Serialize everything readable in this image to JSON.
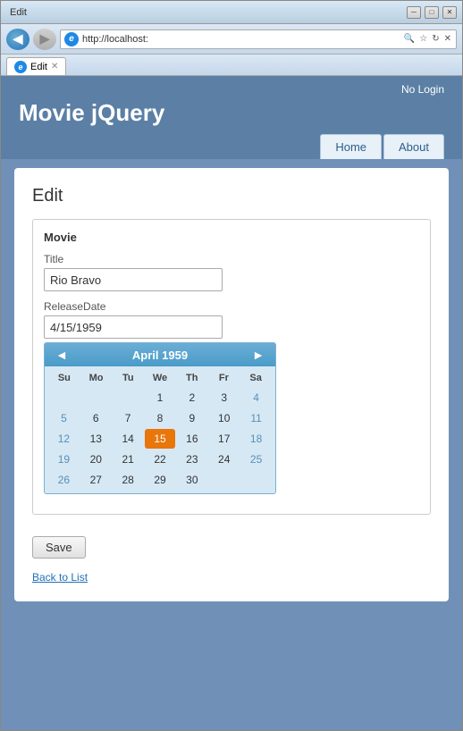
{
  "browser": {
    "title": "Edit",
    "address": "http://localhost:",
    "tab_label": "Edit",
    "back_label": "◀",
    "forward_label": "▶",
    "minimize_label": "─",
    "maximize_label": "□",
    "close_label": "✕",
    "address_search_icon": "🔍",
    "address_refresh_icon": "↻",
    "address_stop_icon": "✕",
    "address_actions": [
      "🔍",
      "☆",
      "↻",
      "✕"
    ]
  },
  "app": {
    "title": "Movie jQuery",
    "no_login": "No Login",
    "nav": {
      "home": "Home",
      "about": "About"
    }
  },
  "page": {
    "edit_title": "Edit",
    "section_label": "Movie",
    "title_label": "Title",
    "title_value": "Rio Bravo",
    "release_label": "ReleaseDate",
    "release_value": "4/15/1959",
    "save_button": "Save",
    "back_to_list": "Back to List"
  },
  "calendar": {
    "month_year": "April 1959",
    "prev_label": "◄",
    "next_label": "►",
    "day_names": [
      "Su",
      "Mo",
      "Tu",
      "We",
      "Th",
      "Fr",
      "Sa"
    ],
    "selected_day": 15,
    "weeks": [
      [
        null,
        null,
        null,
        1,
        2,
        3,
        4
      ],
      [
        5,
        6,
        7,
        8,
        9,
        10,
        11
      ],
      [
        12,
        13,
        14,
        15,
        16,
        17,
        18
      ],
      [
        19,
        20,
        21,
        22,
        23,
        24,
        25
      ],
      [
        26,
        27,
        28,
        29,
        30,
        null,
        null
      ]
    ]
  }
}
